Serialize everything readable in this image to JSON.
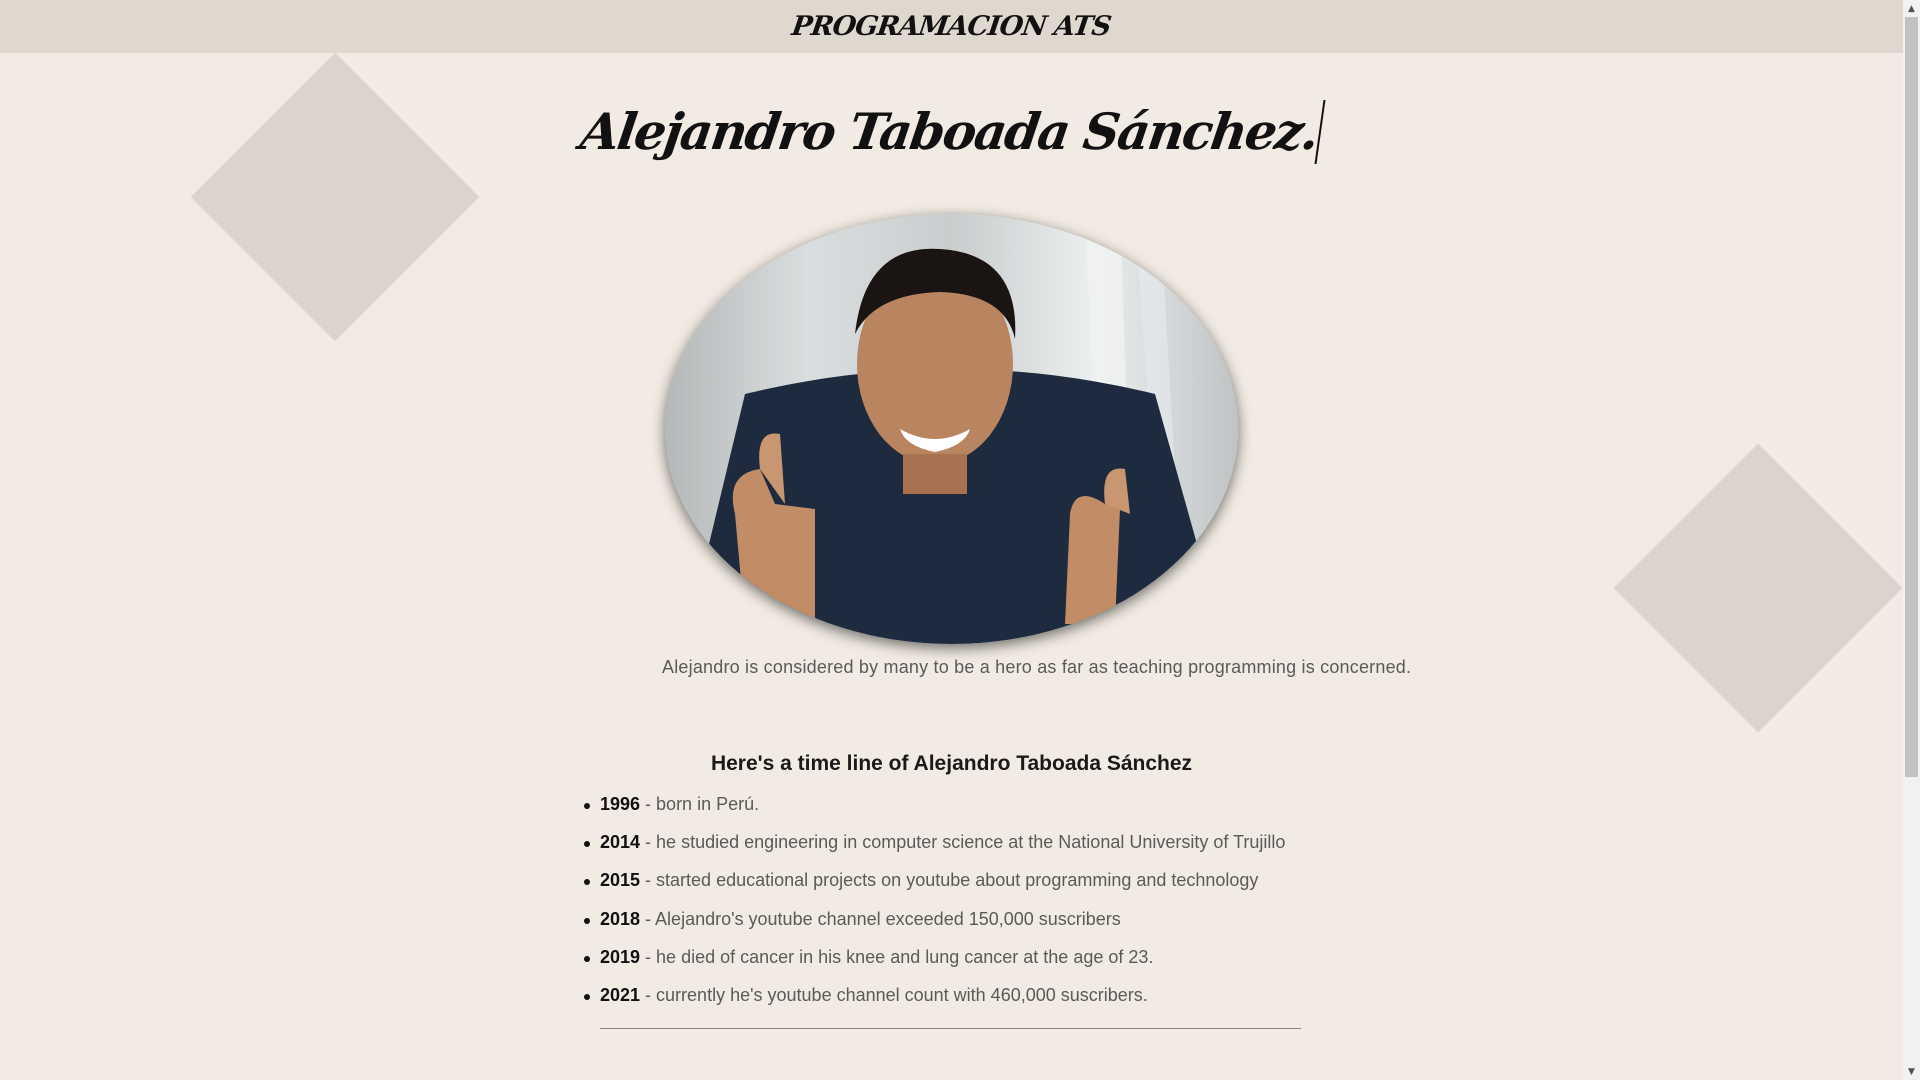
{
  "header": {
    "brand": "PROGRAMACION ATS"
  },
  "title": "Alejandro Taboada Sánchez.",
  "photo": {
    "alt": "Alejandro smiling with thumbs up"
  },
  "caption": "Alejandro is considered by many to be a hero as far as teaching programming is concerned.",
  "timeline": {
    "heading": "Here's a time line of Alejandro Taboada Sánchez",
    "items": [
      {
        "year": "1996",
        "text": " - born in Perú."
      },
      {
        "year": "2014",
        "text": " - he studied engineering in computer science at the National University of Trujillo"
      },
      {
        "year": "2015",
        "text": " - started educational projects on youtube about programming and technology"
      },
      {
        "year": "2018",
        "text": " - Alejandro's youtube channel exceeded 150,000 suscribers"
      },
      {
        "year": "2019",
        "text": " - he died of cancer in his knee and lung cancer at the age of 23."
      },
      {
        "year": "2021",
        "text": " - currently he's youtube channel count with 460,000 suscribers."
      }
    ]
  },
  "scrollbar": {
    "up_icon": "▲",
    "down_icon": "▼"
  },
  "colors": {
    "background": "#f1ebe3",
    "header": "#dfd8cf",
    "diamond": "#dbd4cc"
  }
}
